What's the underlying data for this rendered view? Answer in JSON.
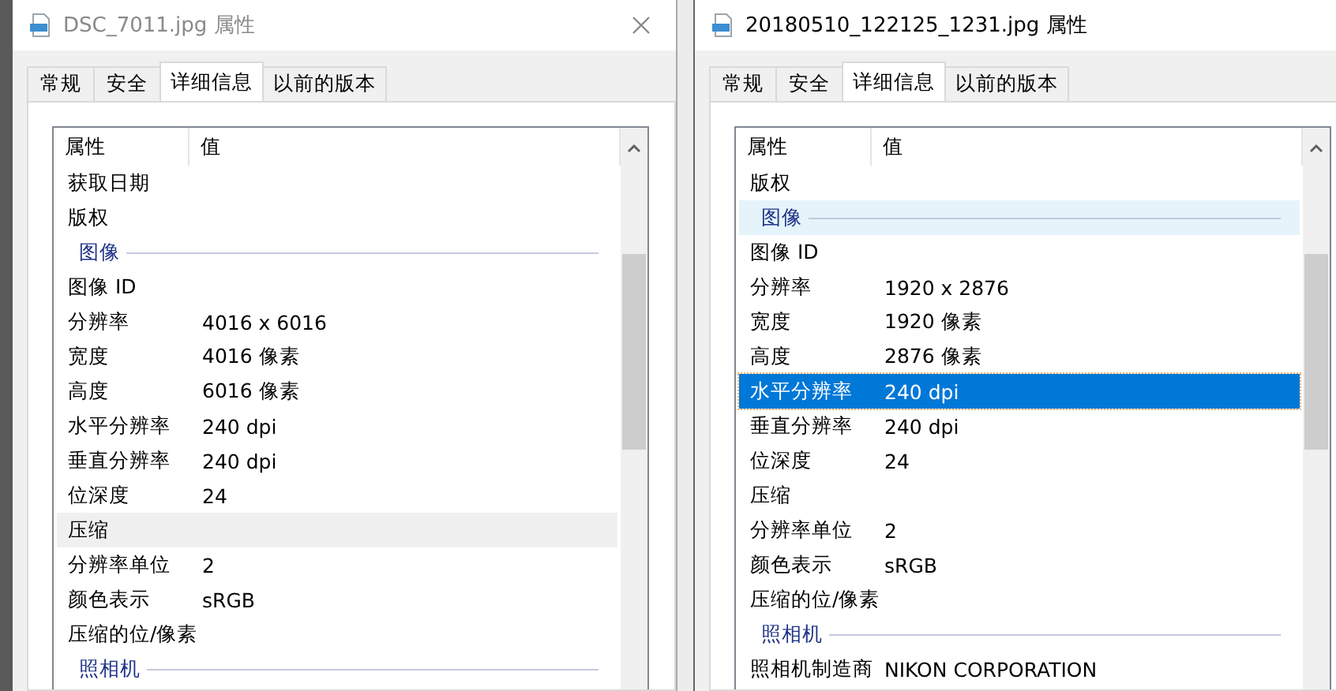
{
  "windows": [
    {
      "title": "DSC_7011.jpg 属性",
      "active": false,
      "has_close": true,
      "tabs": [
        {
          "label": "常规",
          "selected": false
        },
        {
          "label": "安全",
          "selected": false
        },
        {
          "label": "详细信息",
          "selected": true
        },
        {
          "label": "以前的版本",
          "selected": false
        }
      ],
      "columns": [
        "属性",
        "值"
      ],
      "rows": [
        {
          "kind": "property",
          "name": "获取日期",
          "selected": false,
          "hovered": false
        },
        {
          "kind": "property",
          "name": "版权",
          "selected": false,
          "hovered": false
        },
        {
          "kind": "group",
          "name": "图像",
          "selected": false,
          "hovered": false
        },
        {
          "kind": "property",
          "name": "图像 ID",
          "selected": false,
          "hovered": false
        },
        {
          "kind": "property",
          "name": "分辨率",
          "value": "4016 x 6016",
          "selected": false,
          "hovered": false
        },
        {
          "kind": "property",
          "name": "宽度",
          "value": "4016 像素",
          "selected": false,
          "hovered": false
        },
        {
          "kind": "property",
          "name": "高度",
          "value": "6016 像素",
          "selected": false,
          "hovered": false
        },
        {
          "kind": "property",
          "name": "水平分辨率",
          "value": "240 dpi",
          "selected": false,
          "hovered": false
        },
        {
          "kind": "property",
          "name": "垂直分辨率",
          "value": "240 dpi",
          "selected": false,
          "hovered": false
        },
        {
          "kind": "property",
          "name": "位深度",
          "value": "24",
          "selected": false,
          "hovered": false
        },
        {
          "kind": "property",
          "name": "压缩",
          "selected": true,
          "hovered": false
        },
        {
          "kind": "property",
          "name": "分辨率单位",
          "value": "2",
          "selected": false,
          "hovered": false
        },
        {
          "kind": "property",
          "name": "颜色表示",
          "value": "sRGB",
          "selected": false,
          "hovered": false
        },
        {
          "kind": "property",
          "name": "压缩的位/像素",
          "selected": false,
          "hovered": false
        },
        {
          "kind": "group",
          "name": "照相机",
          "selected": false,
          "hovered": false
        }
      ]
    },
    {
      "title": "20180510_122125_1231.jpg 属性",
      "active": true,
      "has_close": false,
      "tabs": [
        {
          "label": "常规",
          "selected": false
        },
        {
          "label": "安全",
          "selected": false
        },
        {
          "label": "详细信息",
          "selected": true
        },
        {
          "label": "以前的版本",
          "selected": false
        }
      ],
      "columns": [
        "属性",
        "值"
      ],
      "rows": [
        {
          "kind": "property",
          "name": "版权",
          "selected": false,
          "hovered": false
        },
        {
          "kind": "group",
          "name": "图像",
          "selected": false,
          "hovered": true
        },
        {
          "kind": "property",
          "name": "图像 ID",
          "selected": false,
          "hovered": false
        },
        {
          "kind": "property",
          "name": "分辨率",
          "value": "1920 x 2876",
          "selected": false,
          "hovered": false
        },
        {
          "kind": "property",
          "name": "宽度",
          "value": "1920 像素",
          "selected": false,
          "hovered": false
        },
        {
          "kind": "property",
          "name": "高度",
          "value": "2876 像素",
          "selected": false,
          "hovered": false
        },
        {
          "kind": "property",
          "name": "水平分辨率",
          "value": "240 dpi",
          "selected": true,
          "hovered": false
        },
        {
          "kind": "property",
          "name": "垂直分辨率",
          "value": "240 dpi",
          "selected": false,
          "hovered": false
        },
        {
          "kind": "property",
          "name": "位深度",
          "value": "24",
          "selected": false,
          "hovered": false
        },
        {
          "kind": "property",
          "name": "压缩",
          "selected": false,
          "hovered": false
        },
        {
          "kind": "property",
          "name": "分辨率单位",
          "value": "2",
          "selected": false,
          "hovered": false
        },
        {
          "kind": "property",
          "name": "颜色表示",
          "value": "sRGB",
          "selected": false,
          "hovered": false
        },
        {
          "kind": "property",
          "name": "压缩的位/像素",
          "selected": false,
          "hovered": false
        },
        {
          "kind": "group",
          "name": "照相机",
          "selected": false,
          "hovered": false
        },
        {
          "kind": "property",
          "name": "照相机制造商",
          "value": "NIKON CORPORATION",
          "selected": false,
          "hovered": false
        }
      ]
    }
  ]
}
